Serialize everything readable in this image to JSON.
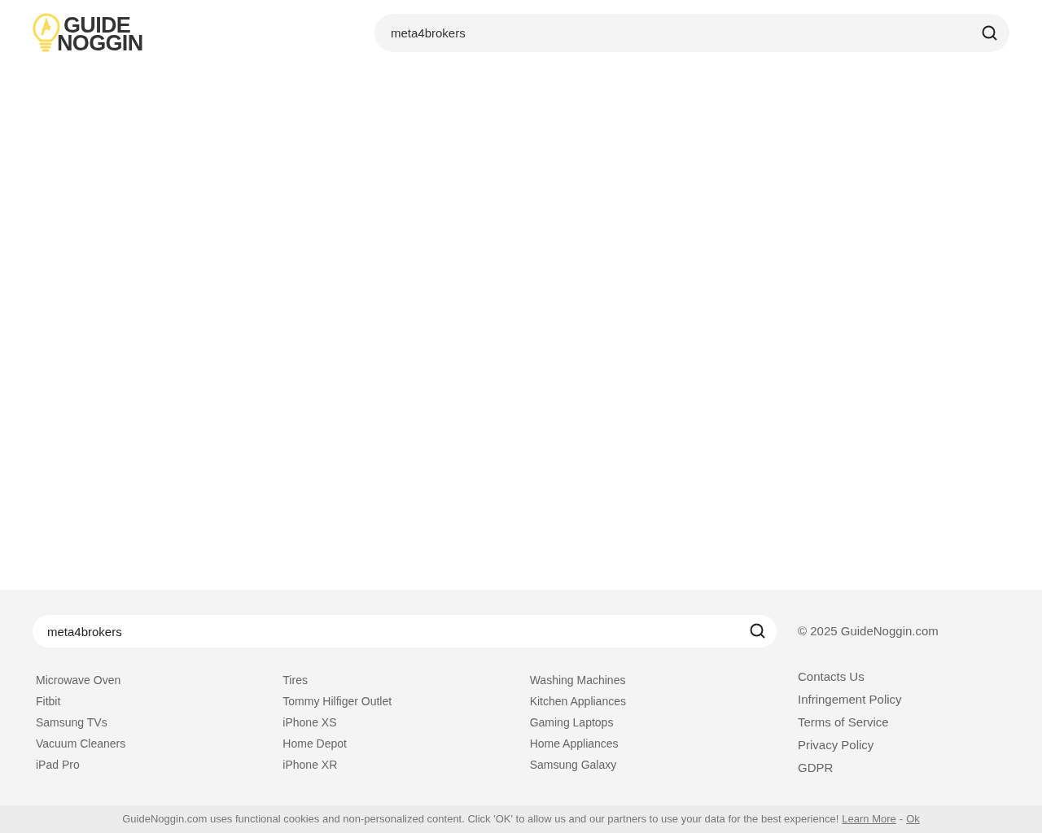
{
  "header": {
    "logo": {
      "line_1": "GUIDE",
      "line_2": "NOGGIN"
    },
    "search": {
      "value": "meta4brokers"
    }
  },
  "footer": {
    "search": {
      "value": "meta4brokers"
    },
    "copyright": "© 2025 GuideNoggin.com",
    "link_columns": [
      [
        "Microwave Oven",
        "Fitbit",
        "Samsung TVs",
        "Vacuum Cleaners",
        "iPad Pro"
      ],
      [
        "Tires",
        "Tommy Hilfiger Outlet",
        "iPhone XS",
        "Home Depot",
        "iPhone XR"
      ],
      [
        "Washing Machines",
        "Kitchen Appliances",
        "Gaming Laptops",
        "Home Appliances",
        "Samsung Galaxy"
      ]
    ],
    "legal_links": [
      "Contacts Us",
      "Infringement Policy",
      "Terms of Service",
      "Privacy Policy",
      "GDPR"
    ]
  },
  "cookie_bar": {
    "message": "GuideNoggin.com uses functional cookies and non-personalized content. Click 'OK' to allow us and our partners to use your data for the best experience!",
    "learn_more": "Learn More",
    "separator": "-",
    "ok": "Ok"
  }
}
